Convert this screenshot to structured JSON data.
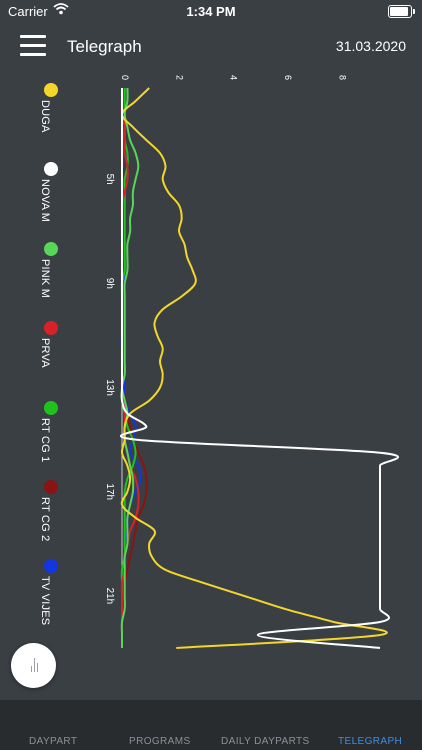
{
  "status_bar": {
    "carrier": "Carrier",
    "time": "1:34 PM"
  },
  "header": {
    "title": "Telegraph",
    "date": "31.03.2020"
  },
  "legend": [
    {
      "label": "DUGA",
      "color": "#f4d62b"
    },
    {
      "label": "NOVA M",
      "color": "#ffffff"
    },
    {
      "label": "PINK M",
      "color": "#58d657"
    },
    {
      "label": "PRVA",
      "color": "#d8222a"
    },
    {
      "label": "RT CG 1",
      "color": "#1fc21f"
    },
    {
      "label": "RT CG 2",
      "color": "#8a1313"
    },
    {
      "label": "TV VIJES",
      "color": "#1436e0"
    }
  ],
  "tabs": [
    {
      "label": "DAYPART",
      "active": false
    },
    {
      "label": "PROGRAMS",
      "active": false
    },
    {
      "label": "DAILY DAYPARTS",
      "active": false
    },
    {
      "label": "TELEGRAPH",
      "active": true
    }
  ],
  "chart_data": {
    "type": "line",
    "orientation": "rotated (time runs top to bottom, value increases to the right)",
    "x_label": "",
    "y_label": "",
    "x_tick_labels": [
      "5h",
      "9h",
      "13h",
      "17h",
      "21h"
    ],
    "x_range": [
      1.5,
      23
    ],
    "y_ticks": [
      0,
      2,
      4,
      6,
      8
    ],
    "y_range": [
      0,
      9.5
    ],
    "grid": false,
    "x": [
      1.5,
      2,
      2.5,
      3,
      3.5,
      4,
      4.5,
      5,
      5.5,
      6,
      6.5,
      7,
      7.5,
      8,
      8.5,
      9,
      9.5,
      10,
      10.5,
      11,
      11.5,
      12,
      12.5,
      13,
      13.5,
      14,
      14.5,
      15,
      15.5,
      16,
      16.5,
      17,
      17.5,
      18,
      18.5,
      19,
      19.5,
      20,
      20.5,
      21,
      21.5,
      22,
      22.5,
      23
    ],
    "series": [
      {
        "name": "DUGA",
        "color": "#f4d62b",
        "values": [
          1.0,
          0.5,
          0.0,
          0.4,
          0.9,
          1.4,
          1.6,
          1.5,
          1.7,
          2.1,
          2.2,
          2.1,
          2.3,
          2.4,
          2.6,
          2.7,
          2.2,
          1.5,
          1.2,
          1.3,
          1.5,
          1.4,
          1.5,
          1.4,
          1.0,
          0.3,
          0.1,
          0.1,
          0.0,
          0.2,
          0.3,
          0.2,
          0.0,
          0.5,
          1.2,
          1.0,
          1.1,
          1.6,
          3.0,
          4.5,
          6.0,
          7.8,
          9.5,
          2.0
        ]
      },
      {
        "name": "NOVA M",
        "color": "#ffffff",
        "values": [
          0,
          0,
          0,
          0,
          0,
          0,
          0,
          0,
          0,
          0,
          0,
          0,
          0,
          0,
          0,
          0,
          0,
          0,
          0,
          0,
          0,
          0,
          0,
          0,
          0,
          0.2,
          0.9,
          0.5,
          9.5,
          9.5,
          9.5,
          9.5,
          9.5,
          9.5,
          9.5,
          9.5,
          9.5,
          9.5,
          9.5,
          9.5,
          9.5,
          9.5,
          5.0,
          9.5
        ]
      },
      {
        "name": "PINK M",
        "color": "#58d657",
        "values": [
          0.2,
          0.2,
          0.1,
          0.2,
          0.3,
          0.5,
          0.6,
          0.5,
          0.4,
          0.4,
          0.3,
          0.3,
          0.2,
          0.2,
          0.2,
          0.1,
          0.1,
          0.1,
          0.1,
          0.1,
          0.1,
          0.1,
          0.1,
          0.0,
          0.1,
          0.2,
          0.1,
          0.1,
          0.2,
          0.3,
          0.4,
          0.4,
          0.3,
          0.2,
          0.2,
          0.2,
          0.1,
          0.1,
          0.1,
          0.1,
          0.1,
          0.0,
          0.0,
          0.0
        ]
      },
      {
        "name": "PRVA",
        "color": "#d8222a",
        "values": [
          0.0,
          0.0,
          0.0,
          0.1,
          0.1,
          0.1,
          0.2,
          0.2,
          0.1,
          0.0,
          0.0,
          0.0,
          0.0,
          0.0,
          0.0,
          0.0,
          0.0,
          0.0,
          0.0,
          0.0,
          0.0,
          0.0,
          0.0,
          0.0,
          0.1,
          0.1,
          0.1,
          0.1,
          0.2,
          0.3,
          0.5,
          0.6,
          0.6,
          0.5,
          0.3,
          0.2,
          0.1,
          0.1,
          0.0,
          0.0,
          0.0,
          0.0,
          0.0,
          0.0
        ]
      },
      {
        "name": "RT CG 1",
        "color": "#1fc21f",
        "values": [
          0.1,
          0.1,
          0.1,
          0.1,
          0.1,
          0.2,
          0.2,
          0.1,
          0.1,
          0.1,
          0.1,
          0.1,
          0.1,
          0.1,
          0.1,
          0.0,
          0.0,
          0.0,
          0.0,
          0.0,
          0.0,
          0.0,
          0.0,
          0.0,
          0.0,
          0.1,
          0.2,
          0.4,
          0.5,
          0.4,
          0.2,
          0.1,
          0.1,
          0.1,
          0.1,
          0.1,
          0.1,
          0.0,
          0.0,
          0.0,
          0.0,
          0.0,
          0.0,
          0.0
        ]
      },
      {
        "name": "RT CG 2",
        "color": "#8a1313",
        "values": [
          0.0,
          0.0,
          0.0,
          0.0,
          0.0,
          0.0,
          0.0,
          0.1,
          0.1,
          0.1,
          0.1,
          0.1,
          0.0,
          0.0,
          0.0,
          0.0,
          0.0,
          0.0,
          0.0,
          0.0,
          0.0,
          0.0,
          0.0,
          0.0,
          0.1,
          0.2,
          0.3,
          0.4,
          0.6,
          0.8,
          0.9,
          0.9,
          0.8,
          0.6,
          0.5,
          0.4,
          0.3,
          0.2,
          0.1,
          0.0,
          0.0,
          0.0,
          0.0,
          0.0
        ]
      },
      {
        "name": "TV VIJES",
        "color": "#1436e0",
        "values": [
          0.1,
          0.1,
          0.1,
          0.1,
          0.0,
          0.1,
          0.2,
          0.1,
          0.1,
          0.1,
          0.1,
          0.1,
          0.1,
          0.1,
          0.1,
          0.1,
          0.1,
          0.1,
          0.1,
          0.0,
          0.0,
          0.1,
          0.1,
          0.1,
          0.1,
          0.3,
          0.5,
          0.4,
          0.3,
          0.6,
          0.7,
          0.5,
          0.3,
          0.2,
          0.2,
          0.1,
          0.1,
          0.1,
          0.1,
          0.0,
          0.0,
          0.0,
          0.0,
          0.0
        ]
      }
    ]
  }
}
